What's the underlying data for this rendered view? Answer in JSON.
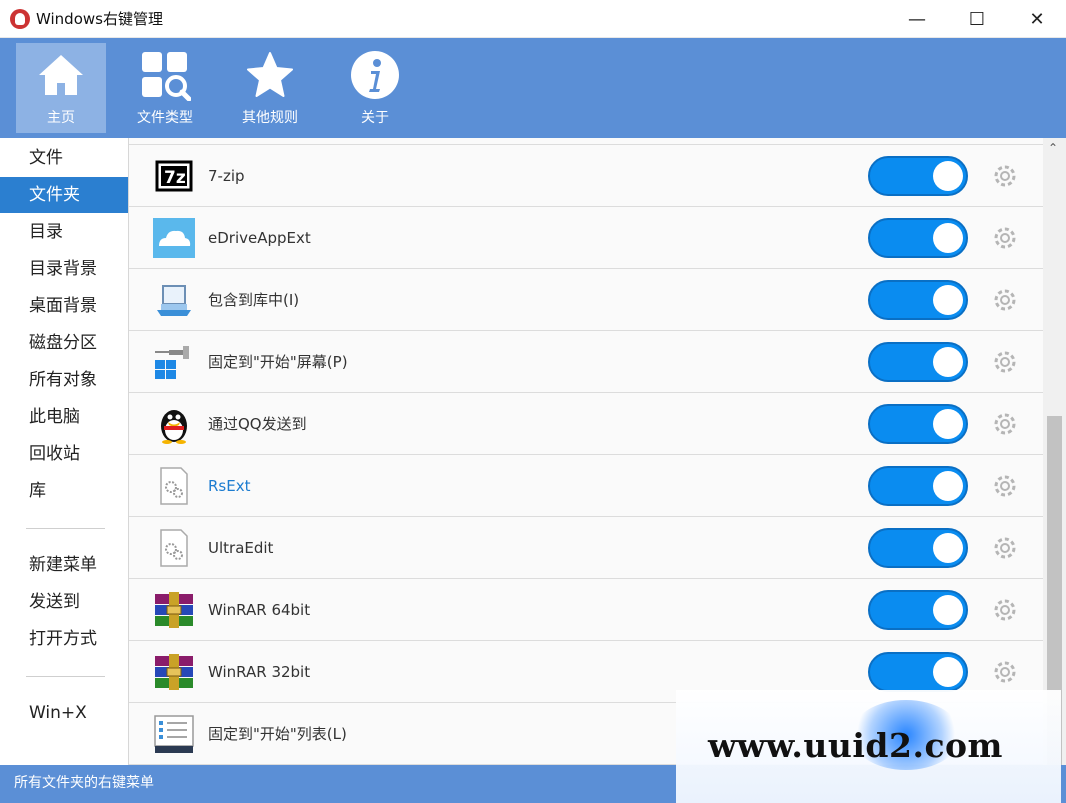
{
  "window": {
    "title": "Windows右键管理",
    "minimize": "—",
    "maximize": "☐",
    "close": "✕"
  },
  "toolbar": {
    "items": [
      {
        "label": "主页",
        "icon": "home-icon"
      },
      {
        "label": "文件类型",
        "icon": "file-types-icon"
      },
      {
        "label": "其他规则",
        "icon": "star-icon"
      },
      {
        "label": "关于",
        "icon": "info-icon"
      }
    ]
  },
  "sidebar": {
    "items": [
      {
        "label": "文件"
      },
      {
        "label": "文件夹"
      },
      {
        "label": "目录"
      },
      {
        "label": "目录背景"
      },
      {
        "label": "桌面背景"
      },
      {
        "label": "磁盘分区"
      },
      {
        "label": "所有对象"
      },
      {
        "label": "此电脑"
      },
      {
        "label": "回收站"
      },
      {
        "label": "库"
      },
      {
        "label": "新建菜单"
      },
      {
        "label": "发送到"
      },
      {
        "label": "打开方式"
      },
      {
        "label": "Win+X"
      }
    ]
  },
  "entries": [
    {
      "label": "7-zip",
      "icon": "7zip-icon",
      "enabled": true
    },
    {
      "label": "eDriveAppExt",
      "icon": "cloud-icon",
      "enabled": true
    },
    {
      "label": "包含到库中(I)",
      "icon": "library-icon",
      "enabled": true
    },
    {
      "label": "固定到\"开始\"屏幕(P)",
      "icon": "pin-start-icon",
      "enabled": true
    },
    {
      "label": "通过QQ发送到",
      "icon": "qq-penguin-icon",
      "enabled": true
    },
    {
      "label": "RsExt",
      "icon": "gear-file-icon",
      "enabled": true
    },
    {
      "label": "UltraEdit",
      "icon": "gear-file-icon",
      "enabled": true
    },
    {
      "label": "WinRAR 64bit",
      "icon": "winrar-icon",
      "enabled": true
    },
    {
      "label": "WinRAR 32bit",
      "icon": "winrar-icon",
      "enabled": true
    },
    {
      "label": "固定到\"开始\"列表(L)",
      "icon": "start-list-icon",
      "enabled": true
    }
  ],
  "status": {
    "text": "所有文件夹的右键菜单"
  },
  "watermark": {
    "text": "www.uuid2.com"
  },
  "colors": {
    "accent": "#5b8fd6",
    "selected": "#2b7fd0",
    "toggle_on": "#0a8cf0"
  }
}
